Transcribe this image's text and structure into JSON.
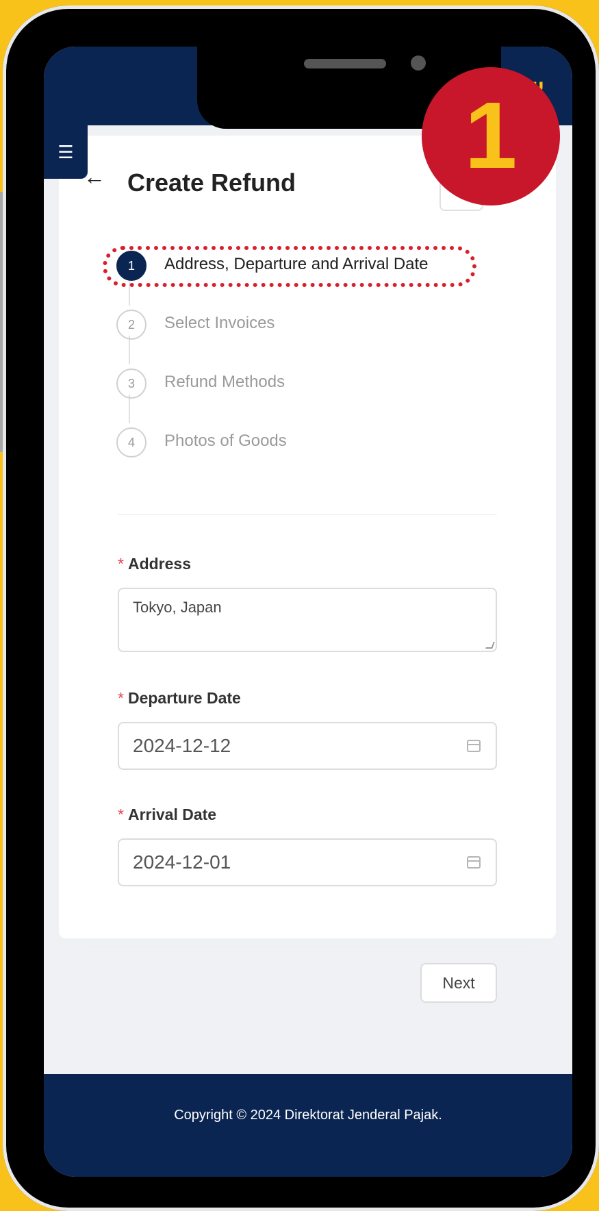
{
  "header": {
    "logo_text": "Ψ"
  },
  "page": {
    "title": "Create Refund"
  },
  "badge": {
    "number": "1"
  },
  "steps": [
    {
      "number": "1",
      "label": "Address, Departure and Arrival Date",
      "active": true
    },
    {
      "number": "2",
      "label": "Select Invoices",
      "active": false
    },
    {
      "number": "3",
      "label": "Refund Methods",
      "active": false
    },
    {
      "number": "4",
      "label": "Photos of Goods",
      "active": false
    }
  ],
  "form": {
    "address": {
      "label": "Address",
      "value": "Tokyo, Japan",
      "required_mark": "*"
    },
    "departure_date": {
      "label": "Departure Date",
      "value": "2024-12-12",
      "required_mark": "*"
    },
    "arrival_date": {
      "label": "Arrival Date",
      "value": "2024-12-01",
      "required_mark": "*"
    }
  },
  "actions": {
    "next_label": "Next"
  },
  "footer": {
    "copyright": "Copyright © 2024 Direktorat Jenderal Pajak."
  },
  "colors": {
    "brand_navy": "#0b2552",
    "accent_yellow": "#f9c21a",
    "badge_red": "#c8162a",
    "required_red": "#e5484d"
  }
}
